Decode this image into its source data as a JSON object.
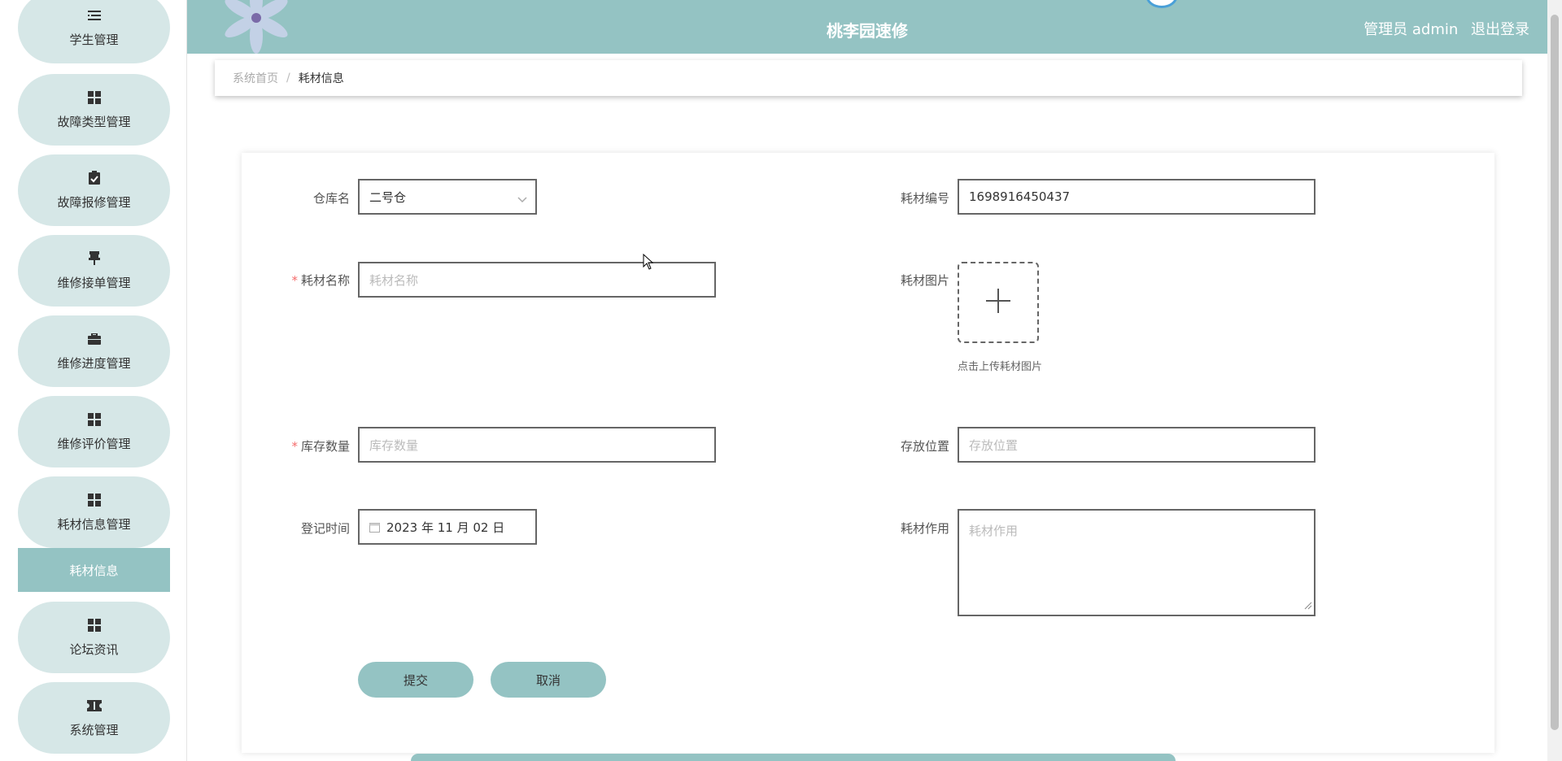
{
  "header": {
    "title": "桃李园速修",
    "user_label": "管理员 admin",
    "logout_label": "退出登录"
  },
  "sidebar": {
    "items": [
      {
        "label": "学生管理",
        "icon": "list-icon"
      },
      {
        "label": "故障类型管理",
        "icon": "grid-icon"
      },
      {
        "label": "故障报修管理",
        "icon": "clipboard-check-icon"
      },
      {
        "label": "维修接单管理",
        "icon": "thumbtack-icon"
      },
      {
        "label": "维修进度管理",
        "icon": "briefcase-icon"
      },
      {
        "label": "维修评价管理",
        "icon": "grid-icon"
      },
      {
        "label": "耗材信息管理",
        "icon": "grid-icon"
      },
      {
        "label": "论坛资讯",
        "icon": "grid-icon"
      },
      {
        "label": "系统管理",
        "icon": "ticket-icon"
      }
    ],
    "active_submenu": "耗材信息"
  },
  "breadcrumb": {
    "home": "系统首页",
    "separator": "/",
    "current": "耗材信息"
  },
  "form": {
    "warehouse": {
      "label": "仓库名",
      "value": "二号仓"
    },
    "code": {
      "label": "耗材编号",
      "value": "1698916450437"
    },
    "name": {
      "label": "耗材名称",
      "placeholder": "耗材名称",
      "required_mark": "*"
    },
    "image": {
      "label": "耗材图片",
      "hint": "点击上传耗材图片"
    },
    "stock": {
      "label": "库存数量",
      "placeholder": "库存数量",
      "required_mark": "*"
    },
    "location": {
      "label": "存放位置",
      "placeholder": "存放位置"
    },
    "reg_time": {
      "label": "登记时间",
      "value": "2023 年 11 月 02 日"
    },
    "usage": {
      "label": "耗材作用",
      "placeholder": "耗材作用"
    },
    "submit_label": "提交",
    "cancel_label": "取消"
  },
  "colors": {
    "accent": "#94c3c3",
    "menu_bg": "#d6e7e7",
    "required": "#f56c6c"
  }
}
